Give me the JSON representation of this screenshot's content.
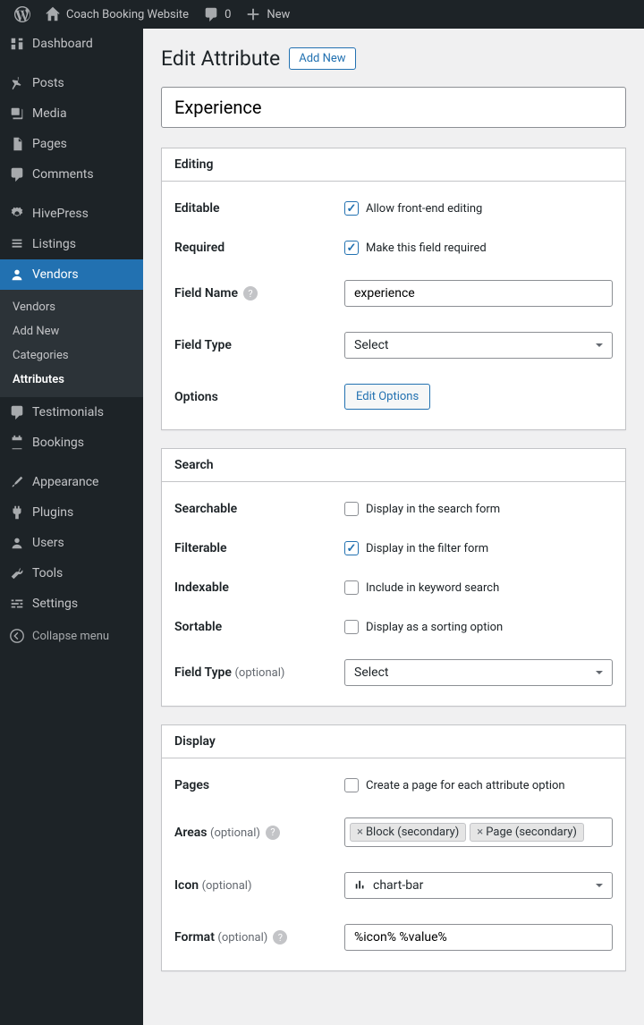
{
  "adminbar": {
    "site_name": "Coach Booking Website",
    "comments_count": "0",
    "new_label": "New"
  },
  "sidebar": {
    "dashboard": "Dashboard",
    "posts": "Posts",
    "media": "Media",
    "pages": "Pages",
    "comments": "Comments",
    "hivepress": "HivePress",
    "listings": "Listings",
    "vendors": "Vendors",
    "testimonials": "Testimonials",
    "bookings": "Bookings",
    "appearance": "Appearance",
    "plugins": "Plugins",
    "users": "Users",
    "tools": "Tools",
    "settings": "Settings",
    "collapse": "Collapse menu",
    "sub": {
      "vendors": "Vendors",
      "add_new": "Add New",
      "categories": "Categories",
      "attributes": "Attributes"
    }
  },
  "page": {
    "title": "Edit Attribute",
    "add_new": "Add New",
    "name_value": "Experience"
  },
  "editing": {
    "heading": "Editing",
    "editable_label": "Editable",
    "editable_text": "Allow front-end editing",
    "required_label": "Required",
    "required_text": "Make this field required",
    "fieldname_label": "Field Name",
    "fieldname_value": "experience",
    "fieldtype_label": "Field Type",
    "fieldtype_value": "Select",
    "options_label": "Options",
    "options_btn": "Edit Options"
  },
  "search": {
    "heading": "Search",
    "searchable_label": "Searchable",
    "searchable_text": "Display in the search form",
    "filterable_label": "Filterable",
    "filterable_text": "Display in the filter form",
    "indexable_label": "Indexable",
    "indexable_text": "Include in keyword search",
    "sortable_label": "Sortable",
    "sortable_text": "Display as a sorting option",
    "fieldtype_label": "Field Type",
    "fieldtype_opt": "(optional)",
    "fieldtype_value": "Select"
  },
  "display": {
    "heading": "Display",
    "pages_label": "Pages",
    "pages_text": "Create a page for each attribute option",
    "areas_label": "Areas",
    "areas_opt": "(optional)",
    "areas_tag1": "Block (secondary)",
    "areas_tag2": "Page (secondary)",
    "icon_label": "Icon",
    "icon_opt": "(optional)",
    "icon_value": "chart-bar",
    "format_label": "Format",
    "format_opt": "(optional)",
    "format_value": "%icon% %value%"
  }
}
